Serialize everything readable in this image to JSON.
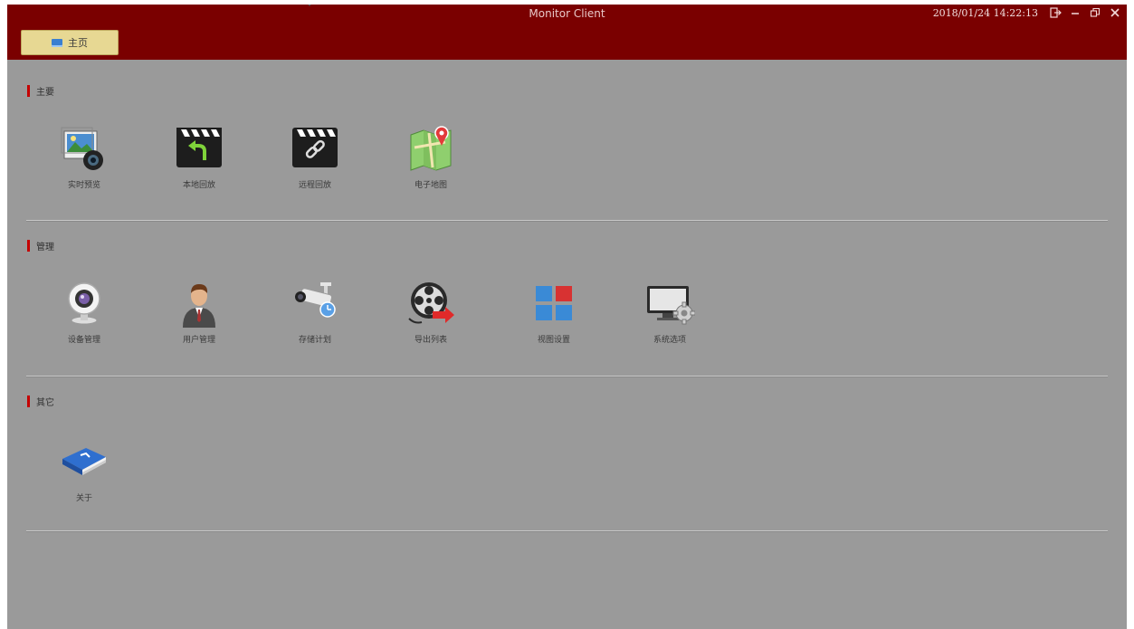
{
  "window": {
    "title": "Monitor Client",
    "datetime": "2018/01/24 14:22:13",
    "controls": {
      "logout_icon": "logout-icon",
      "minimize_icon": "minimize-icon",
      "restore_icon": "restore-icon",
      "close_icon": "close-icon"
    }
  },
  "home_tab": {
    "label": "主页",
    "icon": "monitor-icon"
  },
  "sections": [
    {
      "title": "主要",
      "items": [
        {
          "label": "实时预览",
          "icon": "live-preview-icon"
        },
        {
          "label": "本地回放",
          "icon": "local-playback-icon"
        },
        {
          "label": "远程回放",
          "icon": "remote-playback-icon"
        },
        {
          "label": "电子地图",
          "icon": "e-map-icon"
        }
      ]
    },
    {
      "title": "管理",
      "items": [
        {
          "label": "设备管理",
          "icon": "device-management-icon"
        },
        {
          "label": "用户管理",
          "icon": "user-management-icon"
        },
        {
          "label": "存储计划",
          "icon": "storage-plan-icon"
        },
        {
          "label": "导出列表",
          "icon": "export-list-icon"
        },
        {
          "label": "视图设置",
          "icon": "view-settings-icon"
        },
        {
          "label": "系统选项",
          "icon": "system-options-icon"
        }
      ]
    },
    {
      "title": "其它",
      "items": [
        {
          "label": "关于",
          "icon": "about-icon"
        }
      ]
    }
  ],
  "colors": {
    "titlebar": "#7a0000",
    "background": "#9a9a9a",
    "accent": "#c50000",
    "home_tab": "#e7d893"
  }
}
